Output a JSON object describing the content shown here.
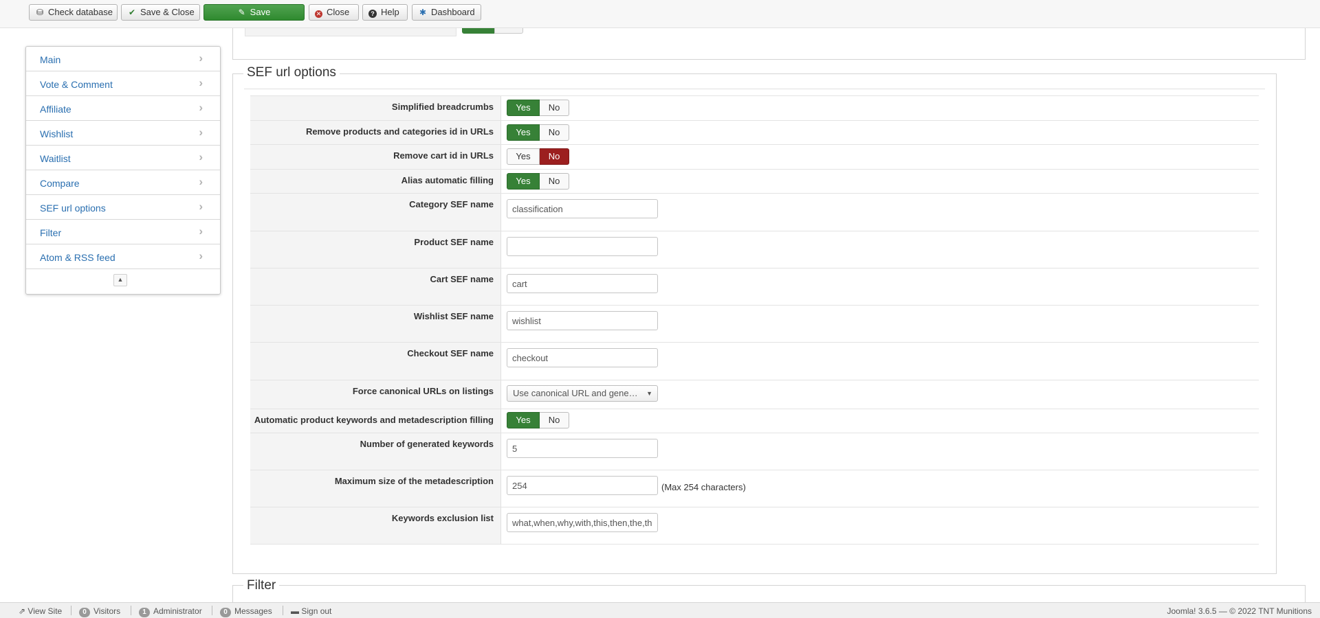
{
  "toolbar": {
    "check_database": "Check database",
    "save_close": "Save & Close",
    "save": "Save",
    "close": "Close",
    "help": "Help",
    "dashboard": "Dashboard"
  },
  "sidebar": {
    "items": [
      {
        "label": "Main"
      },
      {
        "label": "Vote & Comment"
      },
      {
        "label": "Affiliate"
      },
      {
        "label": "Wishlist"
      },
      {
        "label": "Waitlist"
      },
      {
        "label": "Compare"
      },
      {
        "label": "SEF url options"
      },
      {
        "label": "Filter"
      },
      {
        "label": "Atom & RSS feed"
      }
    ]
  },
  "section": {
    "title": "SEF url options",
    "yes": "Yes",
    "no": "No",
    "simplified_breadcrumbs": {
      "label": "Simplified breadcrumbs",
      "value": "Yes"
    },
    "remove_ids": {
      "label": "Remove products and categories id in URLs",
      "value": "Yes"
    },
    "remove_cart_id": {
      "label": "Remove cart id in URLs",
      "value": "No"
    },
    "alias_auto": {
      "label": "Alias automatic filling",
      "value": "Yes"
    },
    "category_sef": {
      "label": "Category SEF name",
      "value": "classification"
    },
    "product_sef": {
      "label": "Product SEF name",
      "value": ""
    },
    "cart_sef": {
      "label": "Cart SEF name",
      "value": "cart"
    },
    "wishlist_sef": {
      "label": "Wishlist SEF name",
      "value": "wishlist"
    },
    "checkout_sef": {
      "label": "Checkout SEF name",
      "value": "checkout"
    },
    "force_canonical": {
      "label": "Force canonical URLs on listings",
      "value": "Use canonical URL and gene…"
    },
    "auto_keywords": {
      "label": "Automatic product keywords and metadescription filling",
      "value": "Yes"
    },
    "num_keywords": {
      "label": "Number of generated keywords",
      "value": "5"
    },
    "max_meta": {
      "label": "Maximum size of the metadescription",
      "value": "254",
      "hint": "(Max 254 characters)"
    },
    "exclusion": {
      "label": "Keywords exclusion list",
      "value": "what,when,why,with,this,then,the,the"
    }
  },
  "filter_section": {
    "title": "Filter"
  },
  "footer": {
    "view_site": "View Site",
    "visitors_count": "0",
    "visitors": "Visitors",
    "admin_count": "1",
    "administrator": "Administrator",
    "messages_count": "0",
    "messages": "Messages",
    "sign_out": "Sign out",
    "right": "Joomla! 3.6.5  —  © 2022 TNT Munitions"
  }
}
